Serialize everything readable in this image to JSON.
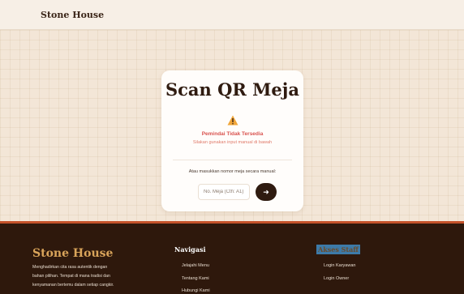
{
  "header": {
    "brand": "Stone House"
  },
  "card": {
    "title": "Scan QR Meja",
    "warning_icon": "warning-triangle-icon",
    "error_title": "Pemindai Tidak Tersedia",
    "error_subtitle": "Silakan gunakan input manual di bawah",
    "manual_label": "Atau masukkan nomor meja secara manual:",
    "input_placeholder": "No. Meja (Cth: A1)",
    "submit_icon": "arrow-right-icon"
  },
  "footer": {
    "brand": "Stone House",
    "description_lines": [
      "Menghadirkan cita rasa autentik dengan",
      "bahan pilihan. Tempat di mana tradisi dan",
      "kenyamanan bertemu dalam setiap cangkir."
    ],
    "nav_heading": "Navigasi",
    "nav_links": [
      "Jelajahi Menu",
      "Tentang Kami",
      "Hubungi Kami"
    ],
    "staff_heading": "Akses Staff",
    "staff_links": [
      "Login Karyawan",
      "Login Owner"
    ]
  },
  "colors": {
    "brand_dark": "#2f1b10",
    "accent": "#c4522a",
    "error": "#d9534f",
    "footer_brand": "#d9a45a"
  }
}
